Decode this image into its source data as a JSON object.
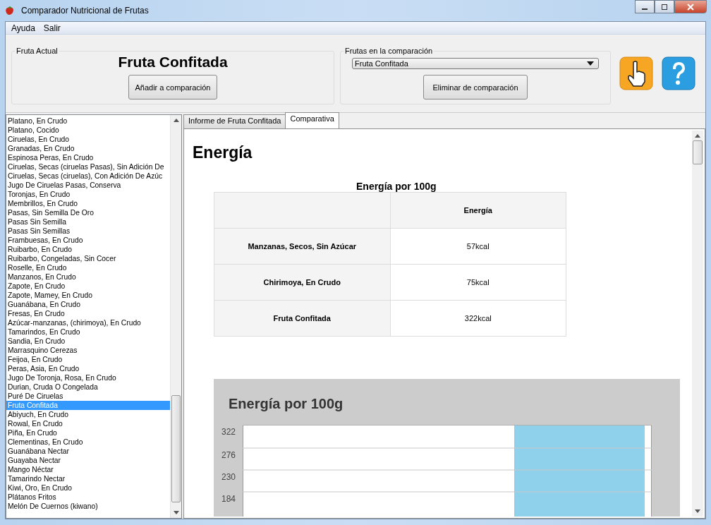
{
  "window": {
    "title": "Comparador Nutricional de Frutas"
  },
  "menu": [
    "Ayuda",
    "Salir"
  ],
  "current_fruit": {
    "group_label": "Fruta Actual",
    "name": "Fruta Confitada",
    "button": "Añadir a comparación"
  },
  "comparison": {
    "group_label": "Frutas en la comparación",
    "dropdown_value": "Fruta Confitada",
    "button": "Eliminar de comparación"
  },
  "fruit_list": [
    {
      "label": "Platano, En Crudo",
      "selected": false
    },
    {
      "label": "Platano, Cocido",
      "selected": false
    },
    {
      "label": "Ciruelas, En Crudo",
      "selected": false
    },
    {
      "label": "Granadas, En Crudo",
      "selected": false
    },
    {
      "label": "Espinosa Peras, En Crudo",
      "selected": false
    },
    {
      "label": "Ciruelas, Secas (ciruelas Pasas), Sin Adición De",
      "selected": false
    },
    {
      "label": "Ciruelas, Secas (ciruelas), Con Adición De Azúc",
      "selected": false
    },
    {
      "label": "Jugo De Ciruelas Pasas, Conserva",
      "selected": false
    },
    {
      "label": "Toronjas, En Crudo",
      "selected": false
    },
    {
      "label": "Membrillos, En Crudo",
      "selected": false
    },
    {
      "label": "Pasas, Sin Semilla De Oro",
      "selected": false
    },
    {
      "label": "Pasas Sin Semilla",
      "selected": false
    },
    {
      "label": "Pasas Sin Semillas",
      "selected": false
    },
    {
      "label": "Frambuesas, En Crudo",
      "selected": false
    },
    {
      "label": "Ruibarbo, En Crudo",
      "selected": false
    },
    {
      "label": "Ruibarbo, Congeladas, Sin Cocer",
      "selected": false
    },
    {
      "label": "Roselle, En Crudo",
      "selected": false
    },
    {
      "label": "Manzanos, En Crudo",
      "selected": false
    },
    {
      "label": "Zapote, En Crudo",
      "selected": false
    },
    {
      "label": "Zapote, Mamey, En Crudo",
      "selected": false
    },
    {
      "label": "Guanábana, En Crudo",
      "selected": false
    },
    {
      "label": "Fresas, En Crudo",
      "selected": false
    },
    {
      "label": "Azúcar-manzanas, (chirimoya), En Crudo",
      "selected": false
    },
    {
      "label": "Tamarindos, En Crudo",
      "selected": false
    },
    {
      "label": "Sandia, En Crudo",
      "selected": false
    },
    {
      "label": "Marrasquino Cerezas",
      "selected": false
    },
    {
      "label": "Feijoa, En Crudo",
      "selected": false
    },
    {
      "label": "Peras, Asia, En Crudo",
      "selected": false
    },
    {
      "label": "Jugo De Toronja, Rosa, En Crudo",
      "selected": false
    },
    {
      "label": "Durian, Cruda O Congelada",
      "selected": false
    },
    {
      "label": "Puré De Ciruelas",
      "selected": false
    },
    {
      "label": "Fruta Confitada",
      "selected": true
    },
    {
      "label": "Abiyuch, En Crudo",
      "selected": false
    },
    {
      "label": "Rowal, En Crudo",
      "selected": false
    },
    {
      "label": "Piña, En Crudo",
      "selected": false
    },
    {
      "label": "Clementinas, En Crudo",
      "selected": false
    },
    {
      "label": "Guanábana Nectar",
      "selected": false
    },
    {
      "label": "Guayaba Nectar",
      "selected": false
    },
    {
      "label": "Mango Néctar",
      "selected": false
    },
    {
      "label": "Tamarindo Nectar",
      "selected": false
    },
    {
      "label": "Kiwi, Oro, En Crudo",
      "selected": false
    },
    {
      "label": "Plátanos Fritos",
      "selected": false
    },
    {
      "label": "Melón De Cuernos (kiwano)",
      "selected": false
    }
  ],
  "tabs": [
    {
      "label": "Informe de Fruta Confitada",
      "selected": false
    },
    {
      "label": "Comparativa",
      "selected": true
    }
  ],
  "report": {
    "heading": "Energía",
    "table_title": "Energía por 100g",
    "table": {
      "columns": [
        "Energía"
      ],
      "rows": [
        {
          "name": "Manzanas, Secos, Sin Azúcar",
          "value": "57kcal"
        },
        {
          "name": "Chirimoya, En Crudo",
          "value": "75kcal"
        },
        {
          "name": "Fruta Confitada",
          "value": "322kcal"
        }
      ]
    },
    "chart": {
      "title": "Energía por 100g",
      "y_axis_labels": [
        "322",
        "276",
        "230",
        "184"
      ]
    }
  }
}
